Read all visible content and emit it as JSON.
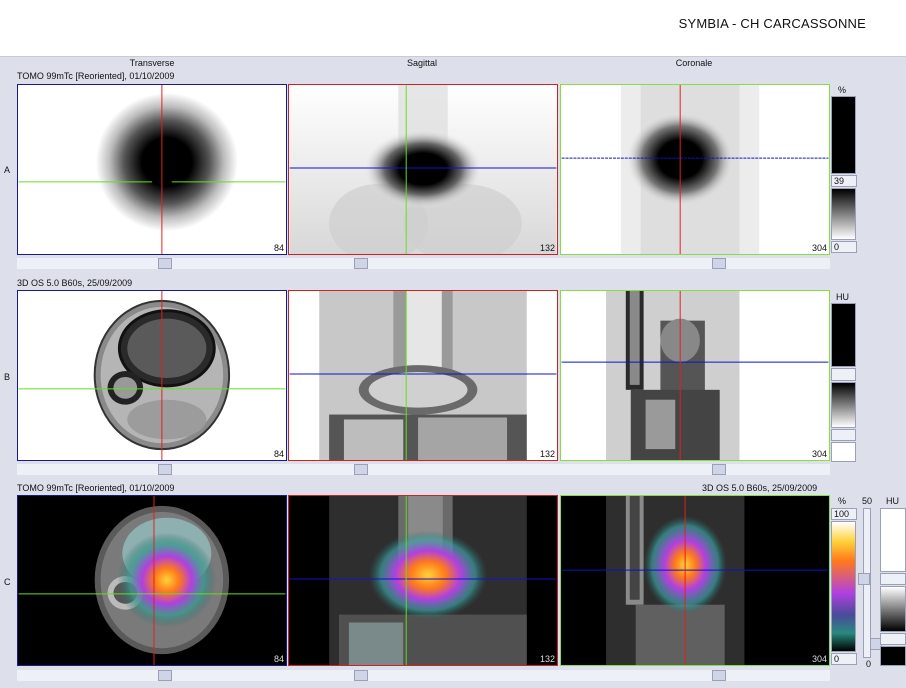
{
  "app": {
    "title": "SYMBIA - CH CARCASSONNE"
  },
  "columns": {
    "transverse": "Transverse",
    "sagittal": "Sagittal",
    "coronal": "Coronale"
  },
  "rows": {
    "a": {
      "label": "A",
      "info": "TOMO 99mTc [Reoriented], 01/10/2009"
    },
    "b": {
      "label": "B",
      "info": "3D  OS  5.0  B60s, 25/09/2009"
    },
    "c": {
      "label": "C",
      "info_left": "TOMO 99mTc [Reoriented], 01/10/2009",
      "info_right": "3D  OS  5.0  B60s, 25/09/2009"
    }
  },
  "slices": {
    "transverse": "84",
    "sagittal": "132",
    "coronal": "304"
  },
  "colorbars": {
    "a": {
      "unit": "%",
      "upper": "39",
      "lower": "0"
    },
    "b": {
      "unit": "HU"
    },
    "c": {
      "unit": "%",
      "upper": "100",
      "lower": "0",
      "window": "50",
      "window_low": "0",
      "unit2": "HU"
    }
  },
  "colors": {
    "transverse_border": "#1a1a8c",
    "sagittal_border": "#cc2222",
    "coronal_border": "#88dd44",
    "crosshair_red": "#dd2222",
    "crosshair_green": "#66dd22",
    "crosshair_blue": "#1111cc"
  }
}
